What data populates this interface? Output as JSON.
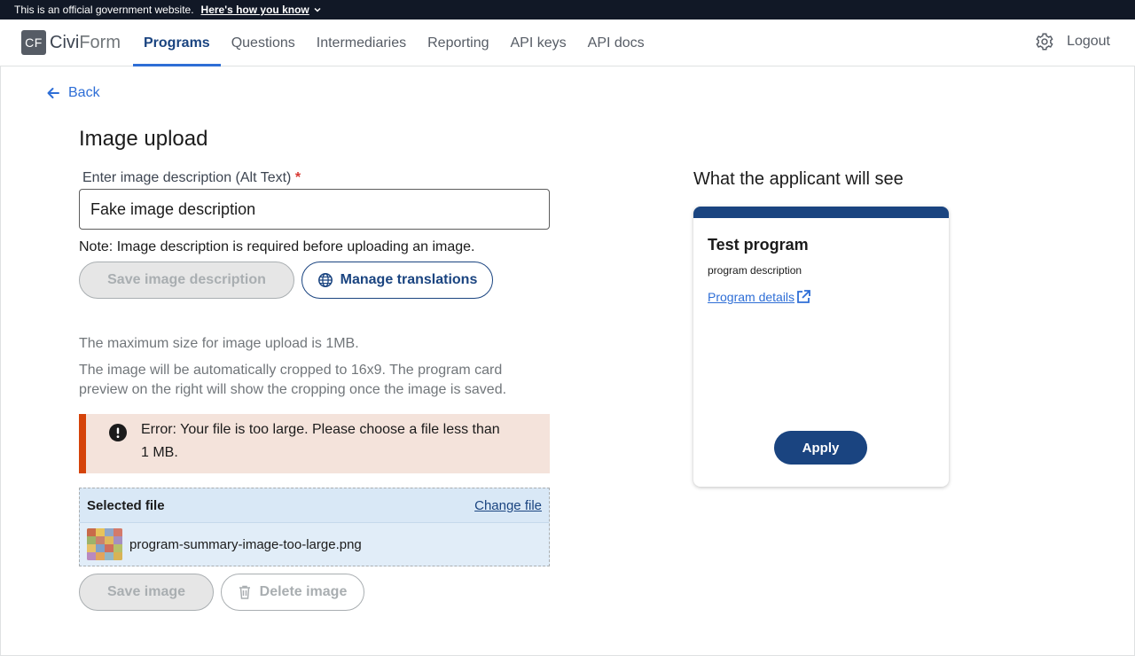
{
  "gov_banner": {
    "text": "This is an official government website.",
    "link": "Here's how you know"
  },
  "header": {
    "logo_badge": "CF",
    "logo_civi": "Civi",
    "logo_form": "Form",
    "nav": [
      "Programs",
      "Questions",
      "Intermediaries",
      "Reporting",
      "API keys",
      "API docs"
    ],
    "active_nav": "Programs",
    "logout": "Logout"
  },
  "page": {
    "back": "Back",
    "title": "Image upload",
    "alt_label": "Enter image description (Alt Text)",
    "required_marker": "*",
    "alt_value": "Fake image description",
    "note": "Note: Image description is required before uploading an image.",
    "save_description": "Save image description",
    "manage_translations": "Manage translations",
    "hint_max": "The maximum size for image upload is 1MB.",
    "hint_crop": "The image will be automatically cropped to 16x9. The program card preview on the right will show the cropping once the image is saved.",
    "error": "Error: Your file is too large. Please choose a file less than 1 MB.",
    "selected_file_label": "Selected file",
    "change_file": "Change file",
    "file_name": "program-summary-image-too-large.png",
    "save_image": "Save image",
    "delete_image": "Delete image"
  },
  "preview": {
    "heading": "What the applicant will see",
    "program_title": "Test program",
    "program_description": "program description",
    "details_link": "Program details",
    "apply": "Apply"
  },
  "colors": {
    "primary": "#1a4480",
    "link": "#2e6ed6",
    "error_bg": "#f4e3db",
    "error_border": "#d54309",
    "file_bg": "#d9e8f6"
  }
}
